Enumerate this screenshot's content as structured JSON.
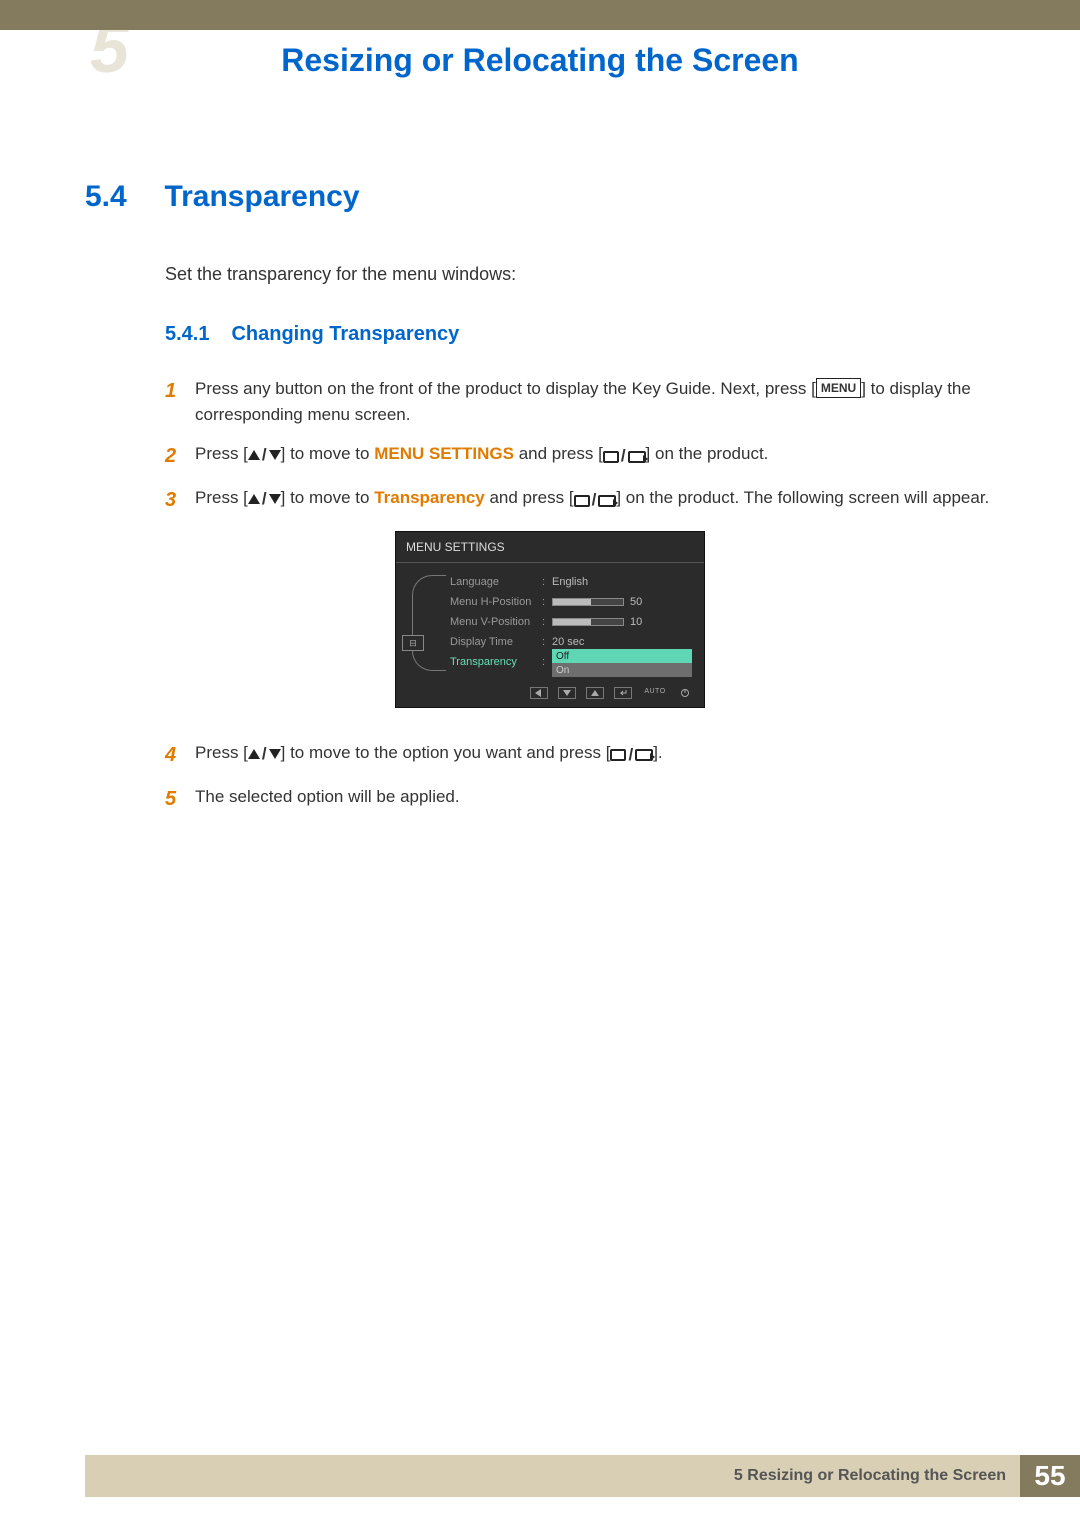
{
  "header": {
    "chapter_big": "5",
    "chapter_title": "Resizing or Relocating the Screen"
  },
  "section": {
    "number": "5.4",
    "title": "Transparency",
    "intro": "Set the transparency for the menu windows:"
  },
  "subsection": {
    "number": "5.4.1",
    "title": "Changing Transparency"
  },
  "steps": {
    "s1a": "Press any button on the front of the product to display the Key Guide. Next, press [",
    "s1_menu": "MENU",
    "s1b": "] to display the corresponding menu screen.",
    "s2a": "Press [",
    "s2b": "] to move to ",
    "s2_bold": "MENU SETTINGS",
    "s2c": " and press [",
    "s2d": "] on the product.",
    "s3a": "Press [",
    "s3b": "] to move to ",
    "s3_bold": "Transparency",
    "s3c": " and press [",
    "s3d": "] on the product. The following screen will appear.",
    "s4a": "Press [",
    "s4b": "] to move to the option you want and press [",
    "s4c": "].",
    "s5": "The selected option will be applied."
  },
  "osd": {
    "title": "MENU SETTINGS",
    "rows": {
      "language": {
        "label": "Language",
        "value": "English"
      },
      "hpos": {
        "label": "Menu H-Position",
        "value": "50"
      },
      "vpos": {
        "label": "Menu V-Position",
        "value": "10"
      },
      "display": {
        "label": "Display Time",
        "value": "20 sec"
      },
      "transparency": {
        "label": "Transparency",
        "off": "Off",
        "on": "On"
      }
    },
    "nav": {
      "auto": "AUTO"
    }
  },
  "footer": {
    "text": "5 Resizing or Relocating the Screen",
    "page": "55"
  }
}
